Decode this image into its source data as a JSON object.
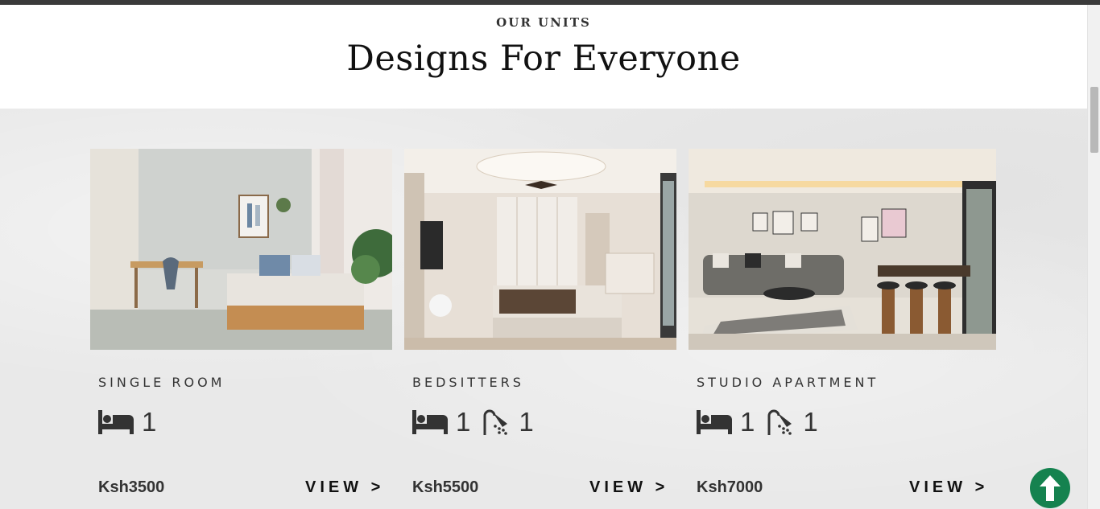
{
  "header": {
    "eyebrow": "OUR UNITS",
    "title": "Designs For Everyone"
  },
  "units": [
    {
      "name": "SINGLE ROOM",
      "bedrooms": "1",
      "price": "Ksh3500",
      "view_label": "VIEW >",
      "image_icon": "bedroom-photo"
    },
    {
      "name": "BEDSITTERS",
      "bedrooms": "1",
      "bathrooms": "1",
      "price": "Ksh5500",
      "view_label": "VIEW >",
      "image_icon": "bedsitter-photo"
    },
    {
      "name": "STUDIO APARTMENT",
      "bedrooms": "1",
      "bathrooms": "1",
      "price": "Ksh7000",
      "view_label": "VIEW >",
      "image_icon": "studio-photo"
    }
  ],
  "icons": {
    "bed": "bed-icon",
    "shower": "shower-icon",
    "back_to_top": "arrow-up-icon"
  },
  "colors": {
    "accent": "#15824f",
    "text": "#333333",
    "background": "#e9e9e9"
  }
}
